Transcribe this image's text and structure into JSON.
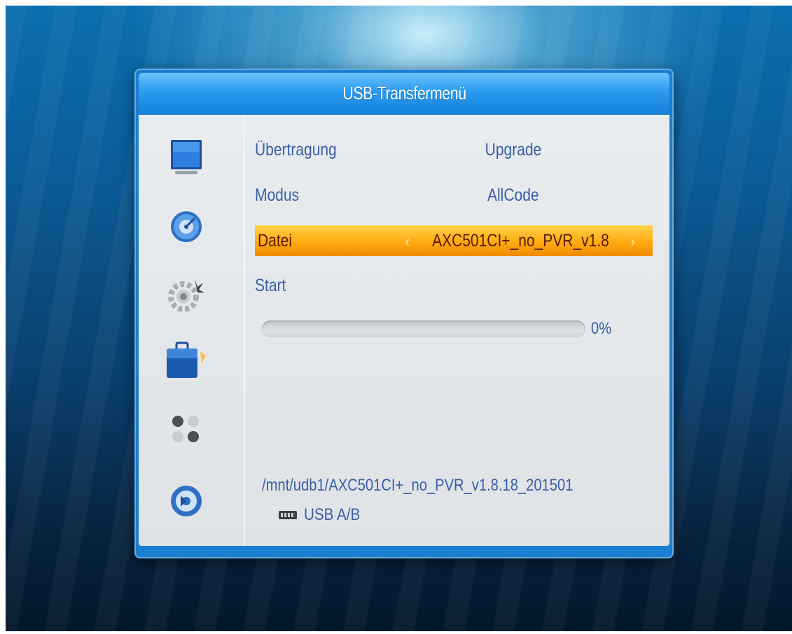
{
  "window": {
    "title": "USB-Transfermenü"
  },
  "sidebar": {
    "icons": [
      {
        "name": "display-icon"
      },
      {
        "name": "satellite-dish-icon"
      },
      {
        "name": "settings-gear-icon"
      },
      {
        "name": "toolbox-icon",
        "selected": true
      },
      {
        "name": "media-dots-icon"
      },
      {
        "name": "usb-disc-icon"
      }
    ]
  },
  "menu": {
    "transfer": {
      "label": "Übertragung",
      "value": "Upgrade"
    },
    "mode": {
      "label": "Modus",
      "value": "AllCode"
    },
    "file": {
      "label": "Datei",
      "value": "AXC501CI+_no_PVR_v1.8",
      "arrow_left": "‹",
      "arrow_right": "›"
    },
    "start": {
      "label": "Start"
    }
  },
  "progress": {
    "percent": 0,
    "text": "0%"
  },
  "footer": {
    "path": "/mnt/udb1/AXC501CI+_no_PVR_v1.8.18_201501",
    "usb_label": "USB A/B"
  },
  "colors": {
    "highlight": "#ffaa10",
    "text": "#3a5fa6",
    "title_bar": "#2b9af0"
  }
}
